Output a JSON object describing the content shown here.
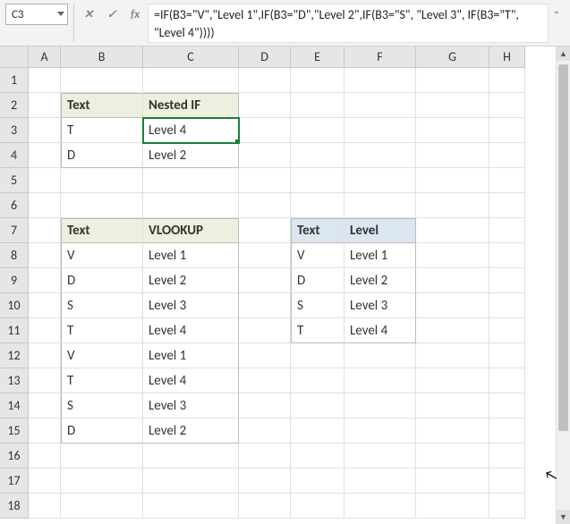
{
  "nameBox": "C3",
  "formula": "=IF(B3=\"V\",\"Level 1\",IF(B3=\"D\",\"Level 2\",IF(B3=\"S\", \"Level 3\", IF(B3=\"T\", \"Level 4\"))))",
  "columns": [
    "A",
    "B",
    "C",
    "D",
    "E",
    "F",
    "G",
    "H"
  ],
  "rowCount": 18,
  "table1": {
    "headers": [
      "Text",
      "Nested IF"
    ],
    "rows": [
      [
        "T",
        "Level 4"
      ],
      [
        "D",
        "Level 2"
      ]
    ]
  },
  "table2": {
    "headers": [
      "Text",
      "VLOOKUP"
    ],
    "rows": [
      [
        "V",
        "Level 1"
      ],
      [
        "D",
        "Level 2"
      ],
      [
        "S",
        "Level 3"
      ],
      [
        "T",
        "Level 4"
      ],
      [
        "V",
        "Level 1"
      ],
      [
        "T",
        "Level 4"
      ],
      [
        "S",
        "Level 3"
      ],
      [
        "D",
        "Level 2"
      ]
    ]
  },
  "table3": {
    "headers": [
      "Text",
      "Level"
    ],
    "rows": [
      [
        "V",
        "Level 1"
      ],
      [
        "D",
        "Level 2"
      ],
      [
        "S",
        "Level 3"
      ],
      [
        "T",
        "Level 4"
      ]
    ]
  },
  "fxLabel": "fx",
  "cancelLabel": "✕",
  "acceptLabel": "✓",
  "chart_data": null
}
